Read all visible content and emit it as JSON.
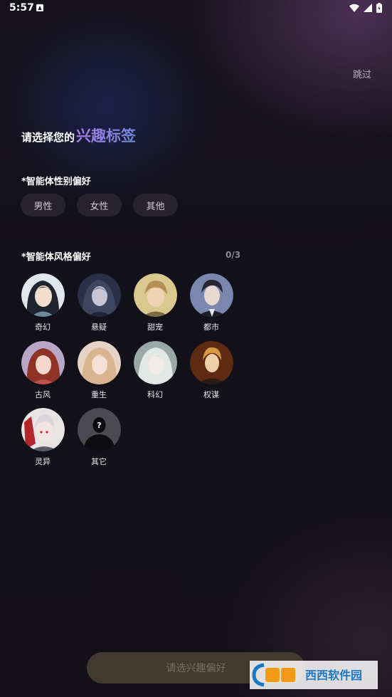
{
  "status_bar": {
    "time": "5:57"
  },
  "header": {
    "skip_label": "跳过"
  },
  "title": {
    "lead": "请选择您的",
    "highlight": "兴趣标签"
  },
  "gender_section": {
    "title": "*智能体性别偏好",
    "options": [
      "男性",
      "女性",
      "其他"
    ]
  },
  "style_section": {
    "title": "*智能体风格偏好",
    "counter": "0/3",
    "items": [
      {
        "label": "奇幻"
      },
      {
        "label": "悬疑"
      },
      {
        "label": "甜宠"
      },
      {
        "label": "都市"
      },
      {
        "label": "古风"
      },
      {
        "label": "重生"
      },
      {
        "label": "科幻"
      },
      {
        "label": "权谋"
      },
      {
        "label": "灵异"
      },
      {
        "label": "其它"
      }
    ]
  },
  "bottom_button": {
    "label": "请选兴趣偏好"
  },
  "watermark": {
    "text": "西西软件园"
  }
}
